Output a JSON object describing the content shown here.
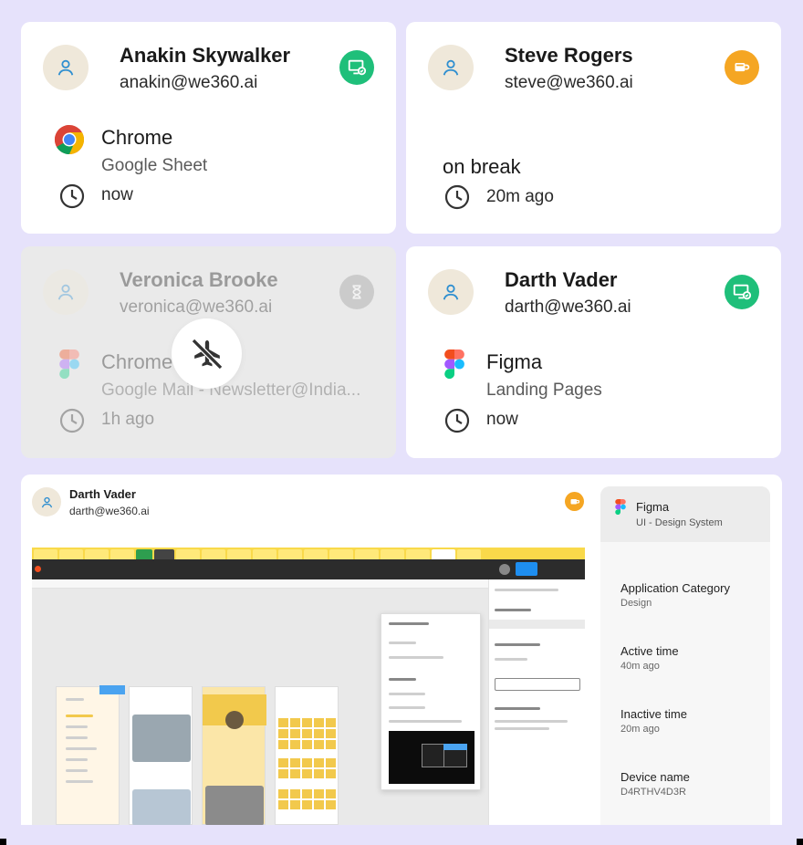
{
  "cards": [
    {
      "name": "Anakin Skywalker",
      "email": "anakin@we360.ai",
      "status": "active",
      "status_color": "#1fbf7a",
      "app": "Chrome",
      "detail": "Google Sheet",
      "time": "now"
    },
    {
      "name": "Steve Rogers",
      "email": "steve@we360.ai",
      "status": "break",
      "status_color": "#f5a623",
      "activity": "on break",
      "time": "20m ago"
    },
    {
      "name": "Veronica Brooke",
      "email": "veronica@we360.ai",
      "status": "idle",
      "status_color": "#9a9a9a",
      "app": "Chrome",
      "detail": "Google Mail - Newsletter@India...",
      "time": "1h ago",
      "offline_icon": "airplane-off-icon"
    },
    {
      "name": "Darth Vader",
      "email": "darth@we360.ai",
      "status": "active",
      "status_color": "#1fbf7a",
      "app": "Figma",
      "detail": "Landing Pages",
      "time": "now"
    }
  ],
  "detail": {
    "name": "Darth Vader",
    "email": "darth@we360.ai",
    "status": "break",
    "status_color": "#f5a623",
    "panel": {
      "app": "Figma",
      "subtitle": "UI - Design System",
      "fields": [
        {
          "label": "Application Category",
          "value": "Design"
        },
        {
          "label": "Active time",
          "value": "40m ago"
        },
        {
          "label": "Inactive time",
          "value": "20m ago"
        },
        {
          "label": "Device name",
          "value": "D4RTHV4D3R"
        }
      ]
    }
  },
  "colors": {
    "background": "#e6e2fb",
    "avatar_bg": "#efe8da",
    "user_icon": "#2f8fd0"
  }
}
